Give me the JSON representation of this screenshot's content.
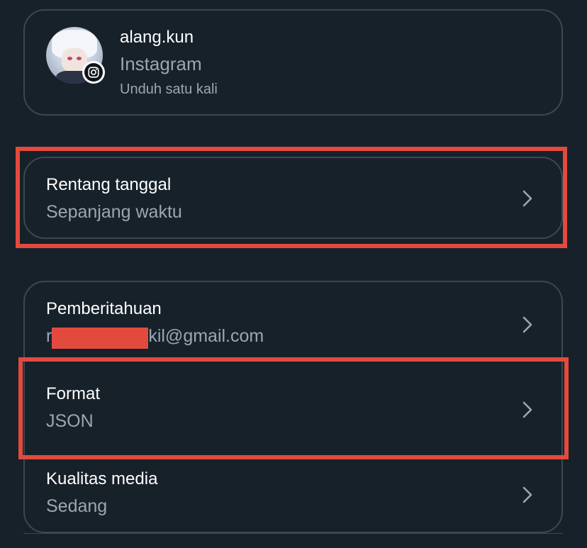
{
  "account": {
    "username": "alang.kun",
    "platform": "Instagram",
    "frequency": "Unduh satu kali"
  },
  "date_range": {
    "label": "Rentang tanggal",
    "value": "Sepanjang waktu"
  },
  "settings": {
    "notification": {
      "label": "Pemberitahuan",
      "value_prefix": "r",
      "value_suffix": "kil@gmail.com"
    },
    "format": {
      "label": "Format",
      "value": "JSON"
    },
    "media_quality": {
      "label": "Kualitas media",
      "value": "Sedang"
    }
  },
  "colors": {
    "background": "#17212a",
    "border": "#3b4752",
    "highlight": "#e34a3e",
    "secondary_text": "#9aa7b3"
  }
}
